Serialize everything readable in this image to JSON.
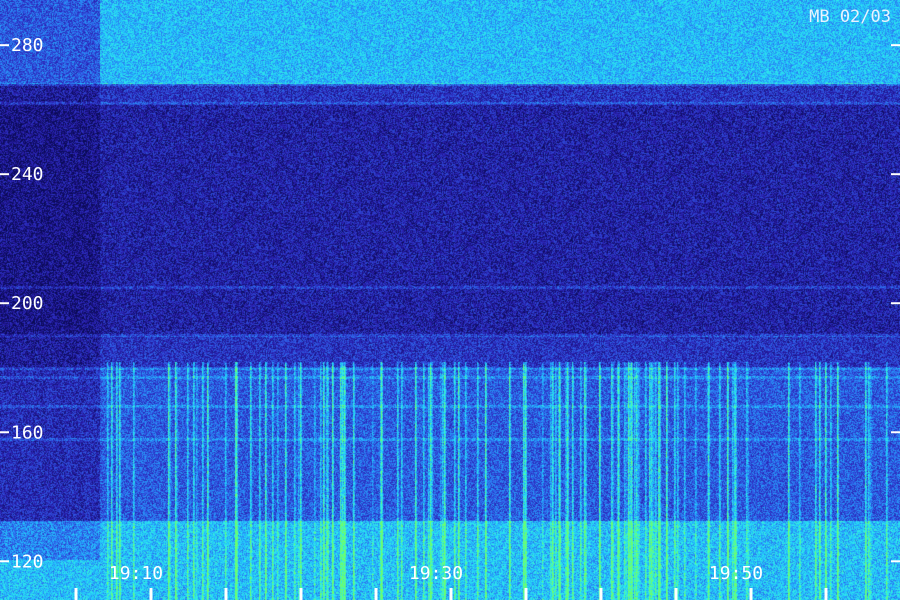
{
  "chart_data": {
    "type": "heatmap",
    "title": "",
    "stamp": "MB 02/03",
    "xlabel": "",
    "ylabel": "",
    "x_ticks": [
      "19:10",
      "19:30",
      "19:50"
    ],
    "y_ticks": [
      120,
      160,
      200,
      240,
      280
    ],
    "ylim": [
      108,
      294
    ],
    "colormap": [
      "#0a0a55",
      "#2a1fb0",
      "#2f5fe8",
      "#22b8ff",
      "#2ff0e8",
      "#6cff6c"
    ],
    "bands": [
      {
        "name": "upper-bright",
        "from": 268,
        "to": 294,
        "level": 0.62
      },
      {
        "name": "mid-dark",
        "from": 190,
        "to": 262,
        "level": 0.18
      },
      {
        "name": "low-active",
        "from": 108,
        "to": 180,
        "level": 0.38
      }
    ]
  }
}
